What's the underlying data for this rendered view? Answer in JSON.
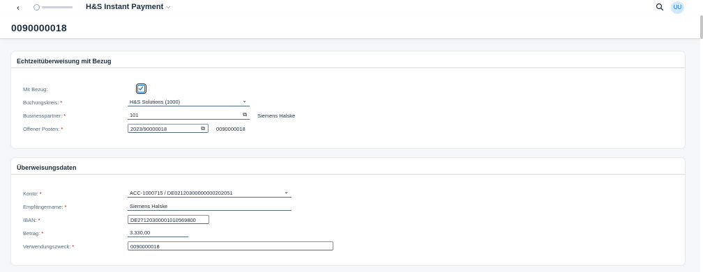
{
  "shellbar": {
    "back_icon": "chevron-left-icon",
    "logo": "company-logo",
    "app_title": "H&S Instant Payment",
    "app_title_icon": "chevron-down-icon",
    "search_icon": "search-icon",
    "avatar_initials": "UU"
  },
  "header": {
    "object_title": "0090000018"
  },
  "section_reference": {
    "title": "Echtzeitüberweisung mit Bezug",
    "mit_bezug_label": "Mit Bezug:",
    "mit_bezug_checked": true,
    "buchungskreis_label": "Buchungskreis:",
    "buchungskreis_value": "H&S Solutions (1000)",
    "businesspartner_label": "Businesspartner:",
    "businesspartner_value": "101",
    "businesspartner_name": "Siemens Halske",
    "offener_posten_label": "Offener Posten:",
    "offener_posten_value": "2023/90000018",
    "offener_posten_ref": "0090000018"
  },
  "section_transfer": {
    "title": "Überweisungsdaten",
    "konto_label": "Konto:",
    "konto_value": "ACC-1000715 / DE02120300000000202051",
    "empfaengername_label": "Empfängername:",
    "empfaengername_value": "Siemens Halske",
    "iban_label": "IBAN:",
    "iban_value": "DE27120300001010569800",
    "betrag_label": "Betrag:",
    "betrag_value": "3.330,00",
    "verwendungszweck_label": "Verwendungszweck:",
    "verwendungszweck_value": "0090000018"
  },
  "required_marker": "*",
  "colors": {
    "accent": "#0a6ed1",
    "required": "#aa0808",
    "text": "#1d2d3e",
    "label": "#556b82"
  }
}
